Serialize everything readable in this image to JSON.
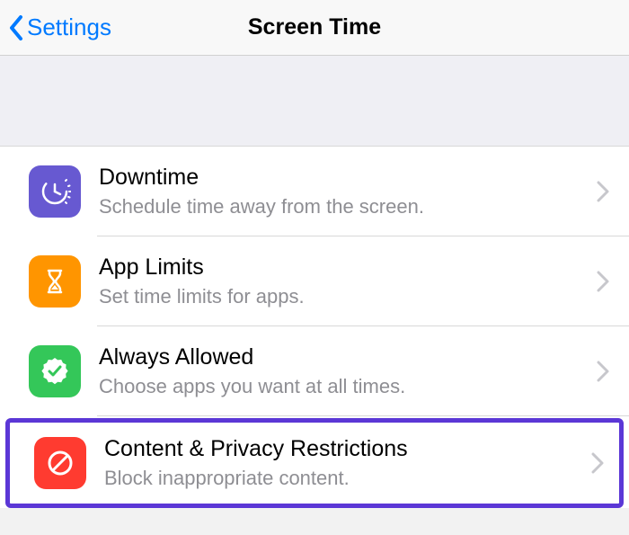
{
  "nav": {
    "back_label": "Settings",
    "title": "Screen Time"
  },
  "rows": [
    {
      "title": "Downtime",
      "subtitle": "Schedule time away from the screen."
    },
    {
      "title": "App Limits",
      "subtitle": "Set time limits for apps."
    },
    {
      "title": "Always Allowed",
      "subtitle": "Choose apps you want at all times."
    },
    {
      "title": "Content & Privacy Restrictions",
      "subtitle": "Block inappropriate content."
    }
  ],
  "colors": {
    "accent": "#007aff",
    "highlight_border": "#5b37d6",
    "downtime_icon": "#6759d1",
    "applimits_icon": "#ff9500",
    "allowed_icon": "#34c759",
    "restrictions_icon": "#ff3b30"
  }
}
